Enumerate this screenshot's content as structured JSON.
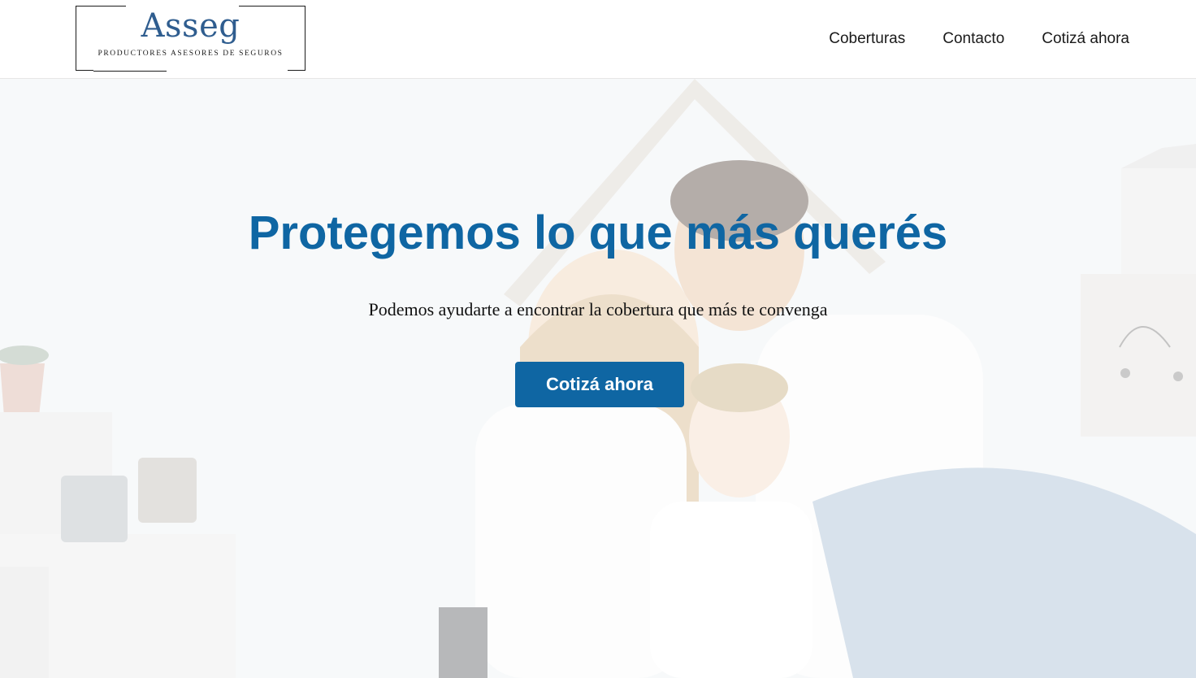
{
  "brand": {
    "name": "Asseg",
    "tagline": "Productores Asesores de Seguros"
  },
  "nav": {
    "items": [
      {
        "label": "Coberturas"
      },
      {
        "label": "Contacto"
      },
      {
        "label": "Cotizá ahora"
      }
    ]
  },
  "hero": {
    "title": "Protegemos lo que más querés",
    "subtitle": "Podemos ayudarte a encontrar la cobertura que más te convenga",
    "cta_label": "Cotizá ahora",
    "image": "family-under-cardboard-roof-photo"
  },
  "colors": {
    "accent": "#0f66a3",
    "logo_text": "#2f5d8f",
    "nav_text": "#1a1a1a"
  }
}
